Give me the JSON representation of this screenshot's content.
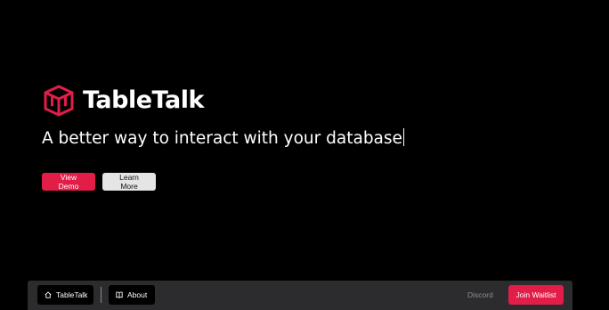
{
  "brand": {
    "name": "TableTalk",
    "logo_icon": "cube-icon",
    "accent_color": "#e11d48"
  },
  "hero": {
    "tagline": "A better way to interact with your database",
    "primary_button": "View Demo",
    "secondary_button": "Learn More"
  },
  "nav": {
    "home_label": "TableTalk",
    "home_icon": "home-icon",
    "about_label": "About",
    "about_icon": "book-icon",
    "discord_label": "Discord",
    "join_label": "Join Waitlist"
  },
  "colors": {
    "background": "#000000",
    "navbar": "#2c2c2e",
    "accent": "#e11d48",
    "secondary_button": "#e5e5e5"
  }
}
